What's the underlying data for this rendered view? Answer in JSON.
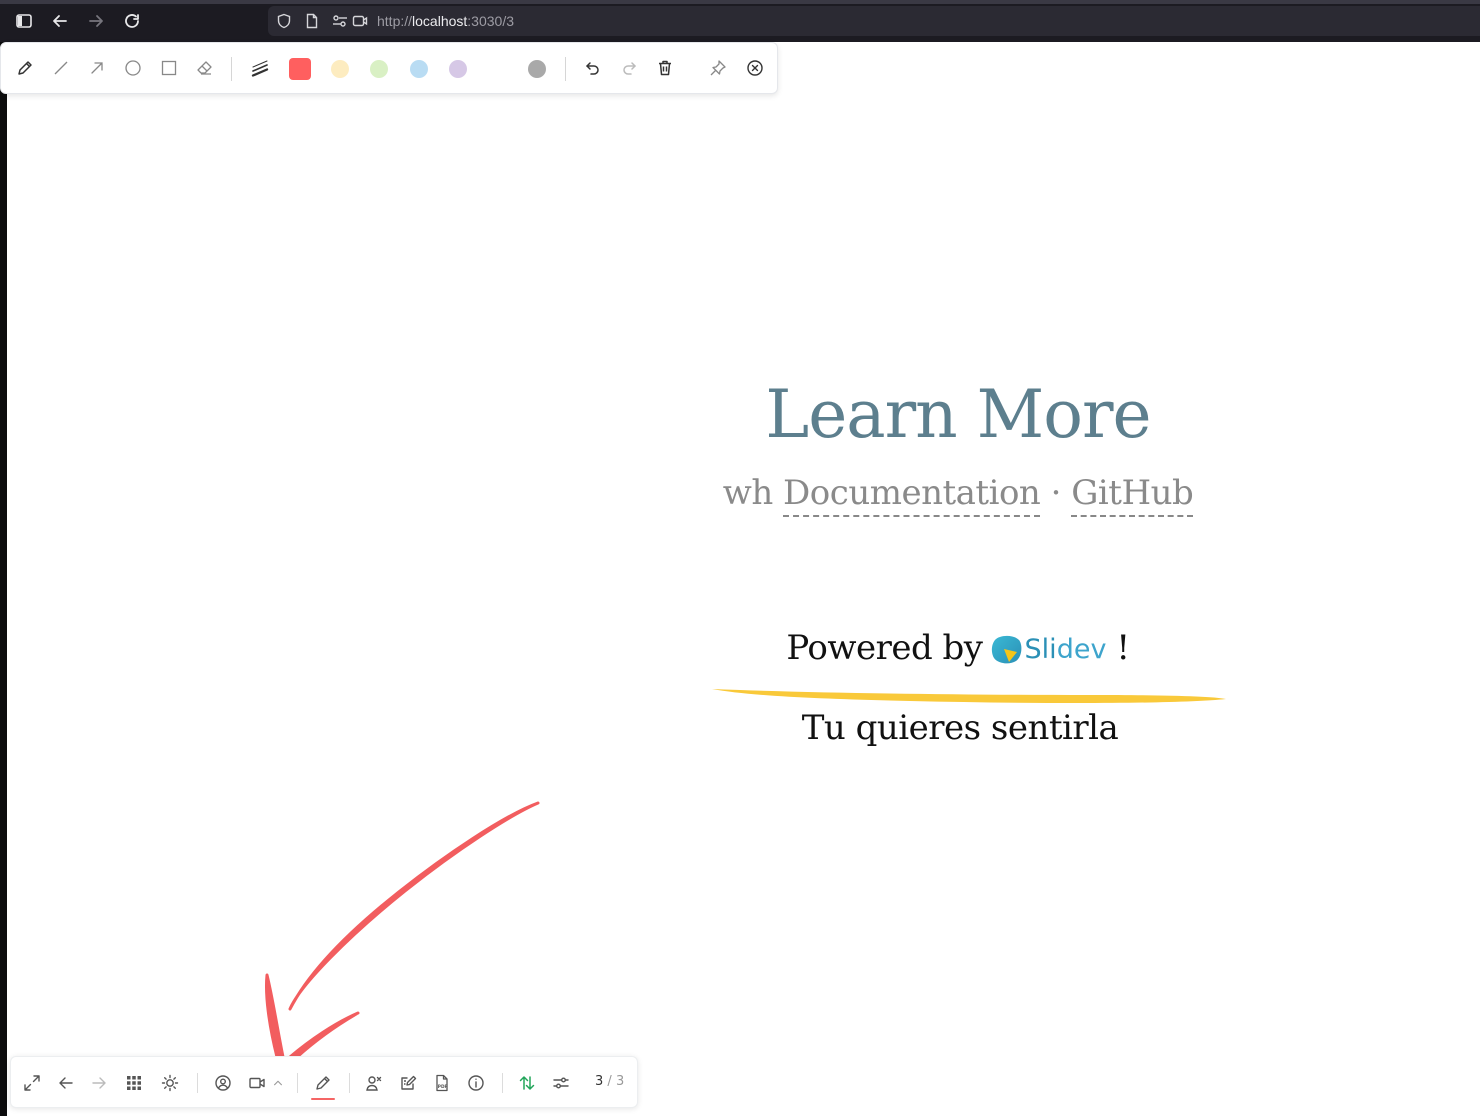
{
  "browser": {
    "url_scheme": "http://",
    "url_host": "localhost",
    "url_path": ":3030/3"
  },
  "draw_toolbar": {
    "tools": [
      "pencil-icon",
      "line-icon",
      "arrow-icon",
      "circle-icon",
      "rectangle-icon",
      "eraser-icon",
      "stroke-width-icon"
    ],
    "colors": {
      "red": "#ff5f5f",
      "yellow": "#fdecc0",
      "green": "#d9f0c4",
      "blue": "#b9dcf3",
      "purple": "#d6c8e6",
      "gray": "#a9a9a9"
    },
    "actions": [
      "undo-icon",
      "redo-icon",
      "trash-icon",
      "pin-icon",
      "close-icon"
    ]
  },
  "slide": {
    "title": "Learn More",
    "links_prefix": "wh",
    "link_docs": "Documentation",
    "links_sep": "·",
    "link_github": "GitHub",
    "powered_by": "Powered by",
    "brand_strong": "Sli",
    "brand_light": "dev",
    "exclaim": "!",
    "subtitle": "Tu quieres sentirla",
    "colors": {
      "title": "#5d7f8e",
      "marker_yellow": "#f9c93a",
      "marker_red": "#f25d5f"
    }
  },
  "bottom_nav": {
    "icons": [
      "fullscreen-icon",
      "prev-arrow-icon",
      "next-arrow-icon",
      "grid-icon",
      "theme-toggle-icon",
      "camera-user-icon",
      "video-icon",
      "chevron-up-icon",
      "pencil-draw-icon",
      "presenter-icon",
      "edit-note-icon",
      "pdf-icon",
      "info-icon",
      "sync-icon",
      "settings-icon"
    ],
    "page_current": "3",
    "page_sep": "/",
    "page_total": "3"
  }
}
